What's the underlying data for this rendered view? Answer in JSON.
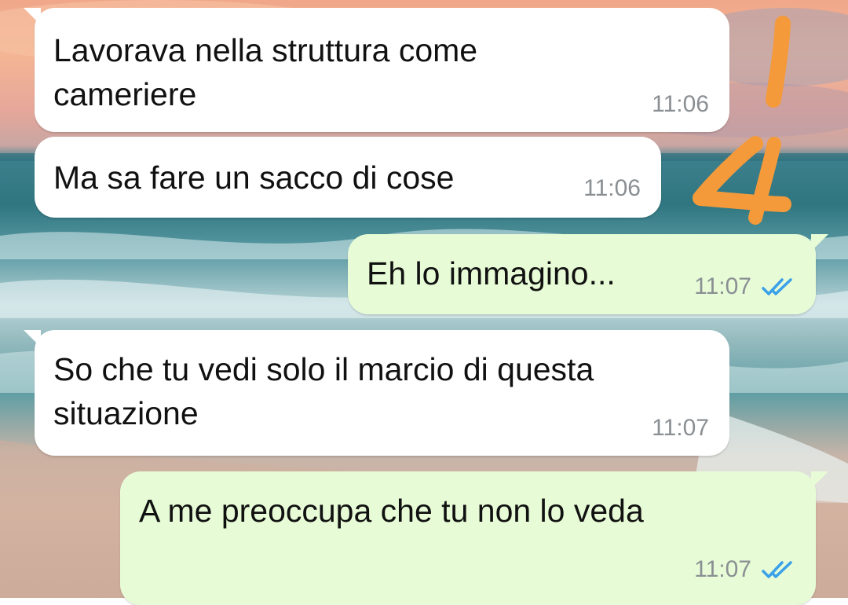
{
  "conversation": {
    "messages": [
      {
        "direction": "in",
        "text": "Lavorava nella struttura come\ncameriere",
        "time": "11:06"
      },
      {
        "direction": "in",
        "text": "Ma sa fare un sacco di cose",
        "time": "11:06"
      },
      {
        "direction": "out",
        "text": "Eh lo immagino...",
        "time": "11:07",
        "status": "read"
      },
      {
        "direction": "in",
        "text": "So che tu vedi solo il marcio di questa\nsituazione",
        "time": "11:07"
      },
      {
        "direction": "out",
        "text": "A me preoccupa che tu non lo veda",
        "time": "11:07",
        "status": "read"
      }
    ]
  },
  "annotation": {
    "color": "#f59a3a",
    "mark": "1/4 handwritten"
  },
  "colors": {
    "incoming_bubble": "#ffffff",
    "outgoing_bubble": "#e7fcd6",
    "timestamp": "#8a8f93",
    "read_ticks": "#3aa0ea"
  }
}
